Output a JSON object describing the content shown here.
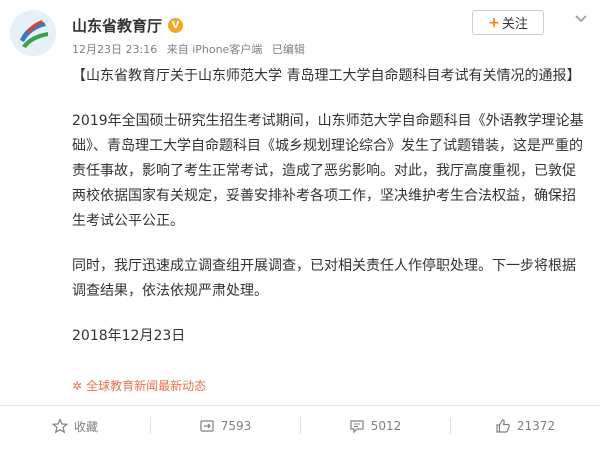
{
  "post": {
    "author": "山东省教育厅",
    "verified_badge": "V",
    "time": "12月23日 23:16",
    "source_device": "来自 iPhone客户端",
    "edited": "已编辑",
    "follow_label": "关注",
    "title": "【山东省教育厅关于山东师范大学 青岛理工大学自命题科目考试有关情况的通报】",
    "paragraph1": "2019年全国硕士研究生招生考试期间，山东师范大学自命题科目《外语教学理论基础》、青岛理工大学自命题科目《城乡规划理论综合》发生了试题错装，这是严重的责任事故，影响了考生正常考试，造成了恶劣影响。对此，我厅高度重视，已敦促两校依据国家有关规定，妥善安排补考各项工作，坚决维护考生合法权益，确保招生考试公平公正。",
    "paragraph2": "同时，我厅迅速成立调查组开展调查，已对相关责任人作停职处理。下一步将根据调查结果，依法依规严肃处理。",
    "date": "2018年12月23日",
    "link_source": "全球教育新闻最新动态"
  },
  "actions": {
    "favorite": "收藏",
    "repost_count": "7593",
    "comment_count": "5012",
    "like_count": "21372"
  },
  "icons": {
    "favorite": "star-icon",
    "repost": "repost-icon",
    "comment": "comment-icon",
    "like": "thumb-up-icon",
    "more": "chevron-down-icon"
  },
  "colors": {
    "accent": "#ff8200",
    "link": "#eb7350",
    "muted": "#808080"
  }
}
